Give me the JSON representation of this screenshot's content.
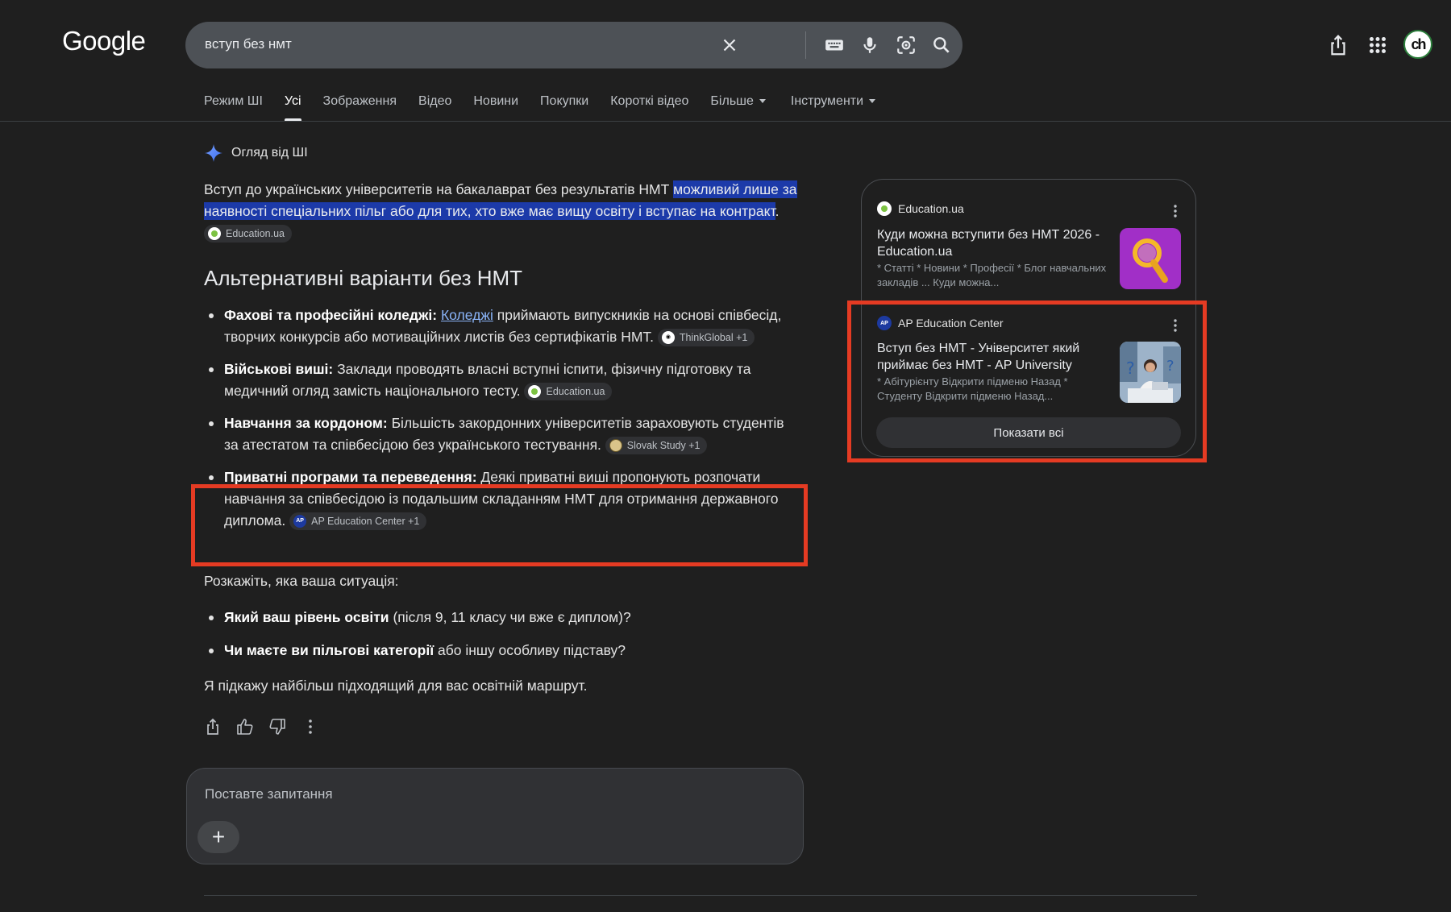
{
  "header": {
    "logo": "Google",
    "search_value": "вступ без нмт",
    "avatar_text": "ch"
  },
  "tabs": [
    {
      "label": "Режим ШІ"
    },
    {
      "label": "Усі"
    },
    {
      "label": "Зображення"
    },
    {
      "label": "Відео"
    },
    {
      "label": "Новини"
    },
    {
      "label": "Покупки"
    },
    {
      "label": "Короткі відео"
    },
    {
      "label": "Більше"
    },
    {
      "label": "Інструменти"
    }
  ],
  "overview": {
    "heading": "Огляд від ШІ",
    "intro_plain": "Вступ до українських університетів на бакалаврат без результатів НМТ ",
    "intro_highlight": "можливий лише за наявності спеціальних пільг або для тих, хто вже має вищу освіту і вступає на контракт",
    "intro_end": ".",
    "intro_source": "Education.ua",
    "section_title": "Альтернативні варіанти без НМТ",
    "items": [
      {
        "bold": "Фахові та професійні коледжі:",
        "link": "Коледжі",
        "text": " приймають випускників на основі співбесід, творчих конкурсів або мотиваційних листів без сертифікатів НМТ.",
        "source": "ThinkGlobal +1"
      },
      {
        "bold": "Військові виші:",
        "text": " Заклади проводять власні вступні іспити, фізичну підготовку та медичний огляд замість національного тесту.",
        "source": "Education.ua"
      },
      {
        "bold": "Навчання за кордоном:",
        "text": " Більшість закордонних університетів зараховують студентів за атестатом та співбесідою без українського тестування.",
        "source": "Slovak Study +1"
      },
      {
        "bold": "Приватні програми та переведення:",
        "text": " Деякі приватні виші пропонують розпочати навчання за співбесідою із подальшим складанням НМТ для отримання державного диплома.",
        "source": "AP Education Center +1"
      }
    ],
    "question_intro": "Розкажіть, яка ваша ситуація:",
    "questions": [
      {
        "bold": "Який ваш рівень освіти",
        "text": " (після 9, 11 класу чи вже є диплом)?"
      },
      {
        "bold": "Чи маєте ви пільгові категорії",
        "text": " або іншу особливу підставу?"
      }
    ],
    "closing": "Я підкажу найбільш підходящий для вас освітній маршрут."
  },
  "ask": {
    "placeholder": "Поставте запитання",
    "plus": "+"
  },
  "panel": {
    "cards": [
      {
        "source": "Education.ua",
        "title": "Куди можна вступити без НМТ 2026 - Education.ua",
        "snippet": "* Статті * Новини * Професії * Блог навчальних закладів ... Куди можна..."
      },
      {
        "source": "AP Education Center",
        "title": "Вступ без НМТ - Університет який приймає без НМТ - AP University",
        "snippet": "* Абітурієнту Відкрити підменю Назад * Студенту Відкрити підменю Назад..."
      }
    ],
    "show_all": "Показати всі"
  },
  "colors": {
    "background": "#1f1f1f",
    "highlight": "#1c3aa9",
    "annotation_red": "#e53b23",
    "link": "#8ab4f8"
  }
}
